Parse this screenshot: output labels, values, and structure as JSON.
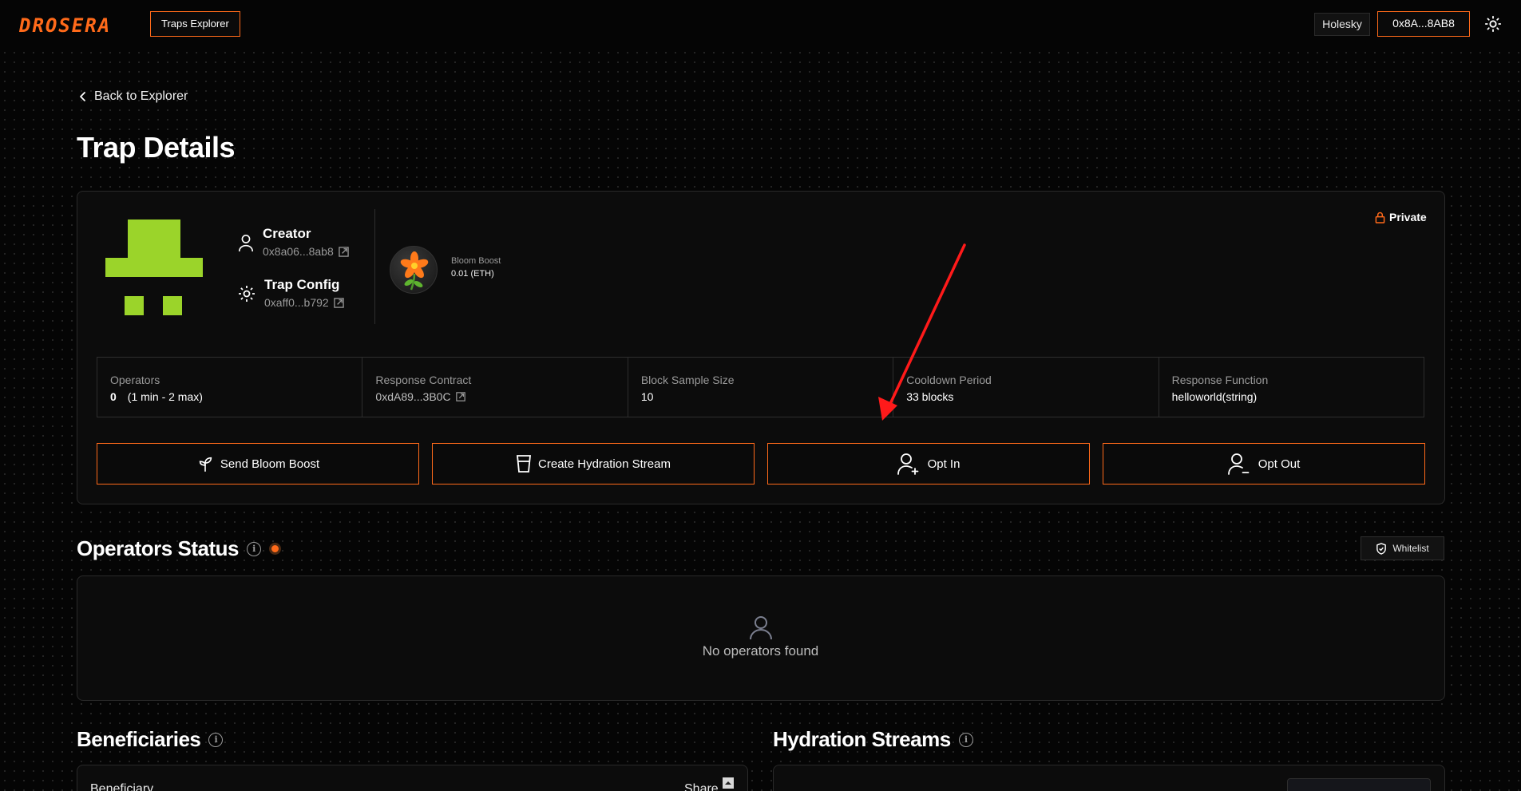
{
  "header": {
    "logo": "DROSERA",
    "explorer_tab": "Traps Explorer",
    "network": "Holesky",
    "wallet": "0x8A...8AB8"
  },
  "back_link": "Back to Explorer",
  "page_title": "Trap Details",
  "trap": {
    "creator_label": "Creator",
    "creator_address": "0x8a06...8ab8",
    "config_label": "Trap Config",
    "config_address": "0xaff0...b792",
    "bloom_label": "Bloom Boost",
    "bloom_value": "0.01 (ETH)",
    "visibility": "Private"
  },
  "info": [
    {
      "label": "Operators",
      "value": "0",
      "extra": "(1 min - 2 max)"
    },
    {
      "label": "Response Contract",
      "value": "0xdA89...3B0C",
      "extra": ""
    },
    {
      "label": "Block Sample Size",
      "value": "10",
      "extra": ""
    },
    {
      "label": "Cooldown Period",
      "value": "33 blocks",
      "extra": ""
    },
    {
      "label": "Response Function",
      "value": "helloworld(string)",
      "extra": ""
    }
  ],
  "actions": {
    "bloom": "Send Bloom Boost",
    "hydration": "Create Hydration Stream",
    "opt_in": "Opt In",
    "opt_out": "Opt Out"
  },
  "operators_status": {
    "title": "Operators Status",
    "whitelist": "Whitelist",
    "empty": "No operators found"
  },
  "beneficiaries": {
    "title": "Beneficiaries",
    "col_beneficiary": "Beneficiary",
    "col_share": "Share"
  },
  "hydration_streams": {
    "title": "Hydration Streams"
  },
  "colors": {
    "accent": "#ff6a1a",
    "avatar": "#9bd42a",
    "annotation": "#ff1a1a"
  }
}
